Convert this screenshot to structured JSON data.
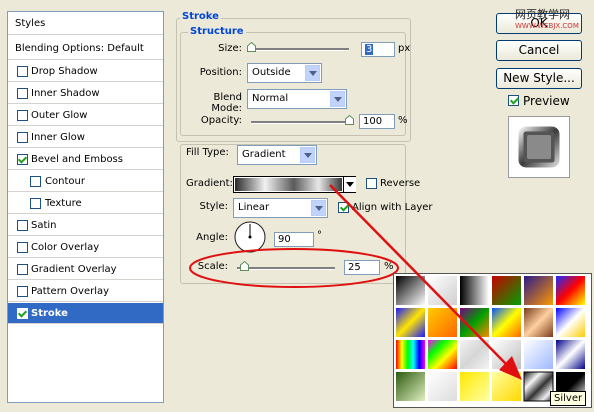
{
  "left_panel": {
    "header": "Styles",
    "blending": "Blending Options: Default",
    "items": [
      {
        "label": "Drop Shadow",
        "checked": false
      },
      {
        "label": "Inner Shadow",
        "checked": false
      },
      {
        "label": "Outer Glow",
        "checked": false
      },
      {
        "label": "Inner Glow",
        "checked": false
      },
      {
        "label": "Bevel and Emboss",
        "checked": true
      },
      {
        "label": "Contour",
        "checked": false
      },
      {
        "label": "Texture",
        "checked": false
      },
      {
        "label": "Satin",
        "checked": false
      },
      {
        "label": "Color Overlay",
        "checked": false
      },
      {
        "label": "Gradient Overlay",
        "checked": false
      },
      {
        "label": "Pattern Overlay",
        "checked": false
      },
      {
        "label": "Stroke",
        "checked": true
      }
    ]
  },
  "stroke": {
    "title": "Stroke",
    "structure_title": "Structure",
    "size_label": "Size:",
    "size_value": "3",
    "size_unit": "px",
    "position_label": "Position:",
    "position_value": "Outside",
    "blend_label": "Blend Mode:",
    "blend_value": "Normal",
    "opacity_label": "Opacity:",
    "opacity_value": "100",
    "opacity_unit": "%"
  },
  "fill": {
    "type_label": "Fill Type:",
    "type_value": "Gradient",
    "gradient_label": "Gradient:",
    "reverse_label": "Reverse",
    "reverse_checked": false,
    "style_label": "Style:",
    "style_value": "Linear",
    "align_label": "Align with Layer",
    "align_checked": true,
    "angle_label": "Angle:",
    "angle_value": "90",
    "angle_unit": "°",
    "scale_label": "Scale:",
    "scale_value": "25",
    "scale_unit": "%"
  },
  "buttons": {
    "ok": "OK",
    "cancel": "Cancel",
    "new_style": "New Style...",
    "preview": "Preview",
    "preview_checked": true
  },
  "watermark": {
    "line1": "网页教学网",
    "line2": "WWW.WEBJX.COM"
  },
  "tooltip": "Silver"
}
